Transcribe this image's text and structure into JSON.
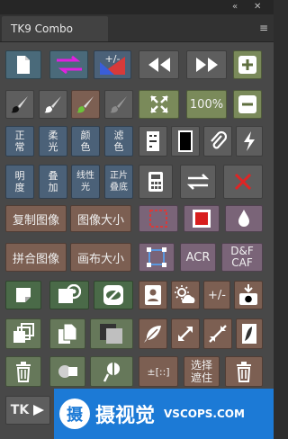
{
  "window": {
    "collapse_glyph": "«",
    "close_glyph": "✕"
  },
  "panel": {
    "tab_label": "TK9 Combo",
    "menu_glyph": "≡"
  },
  "buttons": {
    "pct": "100%",
    "cjk_zhengchang": [
      "正",
      "常"
    ],
    "cjk_rouguang": [
      "柔",
      "光"
    ],
    "cjk_yanse": [
      "颜",
      "色"
    ],
    "cjk_lvse": [
      "滤",
      "色"
    ],
    "cjk_mingdu": [
      "明",
      "度"
    ],
    "cjk_diejia": [
      "叠",
      "加"
    ],
    "cjk_xianxing": [
      "线性",
      "光"
    ],
    "cjk_zhengpian": [
      "正片",
      "叠底"
    ],
    "copy_image": "复制图像",
    "image_size": "图像大小",
    "merge_image": "拼合图像",
    "canvas_size": "画布大小",
    "acr": "ACR",
    "dfcaf": [
      "D&F",
      "CAF"
    ],
    "plusminus": "+/-",
    "sel_plusminus": "±[::]",
    "select_mask": [
      "选择",
      "遮住"
    ],
    "tk": "TK"
  },
  "watermark": {
    "logo": "摄",
    "name": "摄视觉",
    "url": "VSCOPS.COM"
  }
}
